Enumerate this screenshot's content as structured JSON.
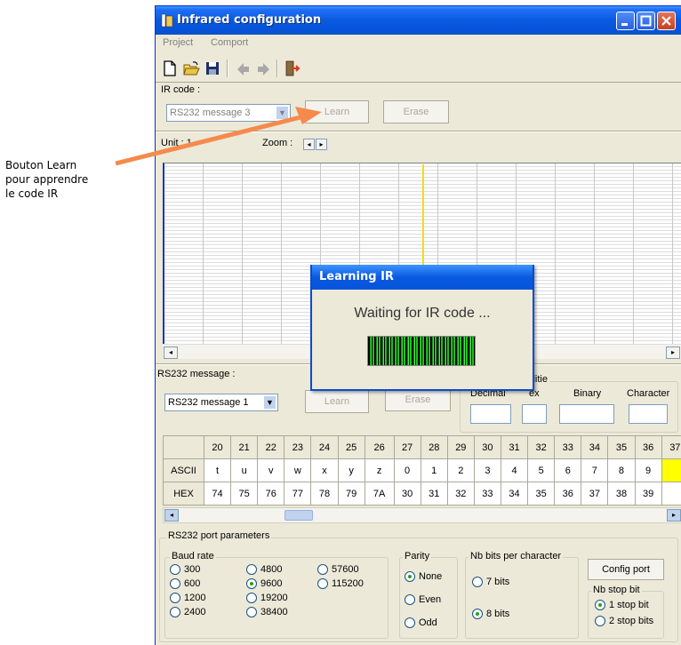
{
  "annotation": {
    "lines": [
      "Bouton Learn",
      "pour apprendre",
      "le code IR"
    ],
    "arrow_color": "#f58a4c"
  },
  "window": {
    "title": "Infrared configuration",
    "menu": [
      "Project",
      "Comport"
    ]
  },
  "toolbar": {
    "icons": [
      "new-file-icon",
      "open-folder-icon",
      "save-icon",
      "left-arrow-icon",
      "right-arrow-icon",
      "exit-icon"
    ]
  },
  "ir_code": {
    "label": "IR code :",
    "selected": "RS232 message 3",
    "learn_label": "Learn",
    "erase_label": "Erase"
  },
  "graph": {
    "unit_label": "Unit : 1",
    "zoom_label": "Zoom :"
  },
  "dialog": {
    "title": "Learning IR",
    "message": "Waiting for  IR code ..."
  },
  "rs232_message": {
    "label": "RS232 message :",
    "selected": "RS232 message 1",
    "learn_label": "Learn",
    "erase_label": "Erase",
    "utility_label": "ilitie",
    "decimal_label": "Decimal",
    "hex_label": "ex",
    "binary_label": "Binary",
    "character_label": "Character"
  },
  "ascii_table": {
    "columns": [
      "20",
      "21",
      "22",
      "23",
      "24",
      "25",
      "26",
      "27",
      "28",
      "29",
      "30",
      "31",
      "32",
      "33",
      "34",
      "35",
      "36",
      "37"
    ],
    "ascii_label": "ASCII",
    "ascii": [
      "t",
      "u",
      "v",
      "w",
      "x",
      "y",
      "z",
      "0",
      "1",
      "2",
      "3",
      "4",
      "5",
      "6",
      "7",
      "8",
      "9",
      ""
    ],
    "hex_label": "HEX",
    "hex": [
      "74",
      "75",
      "76",
      "77",
      "78",
      "79",
      "7A",
      "30",
      "31",
      "32",
      "33",
      "34",
      "35",
      "36",
      "37",
      "38",
      "39",
      ""
    ],
    "highlight_color": "#ffff00"
  },
  "port_params": {
    "title": "RS232 port parameters",
    "baud_title": "Baud rate",
    "baud_col1": [
      "300",
      "600",
      "1200",
      "2400"
    ],
    "baud_col2": [
      "4800",
      "9600",
      "19200",
      "38400"
    ],
    "baud_col3": [
      "57600",
      "115200"
    ],
    "baud_selected": "9600",
    "parity_title": "Parity",
    "parity": [
      "None",
      "Even",
      "Odd"
    ],
    "parity_selected": "None",
    "bits_title": "Nb bits per character",
    "bits": [
      "7 bits",
      "8 bits"
    ],
    "bits_selected": "8 bits",
    "config_button": "Config port",
    "stop_title": "Nb stop bit",
    "stop": [
      "1 stop bit",
      "2 stop bits"
    ],
    "stop_selected": "1 stop bit"
  }
}
